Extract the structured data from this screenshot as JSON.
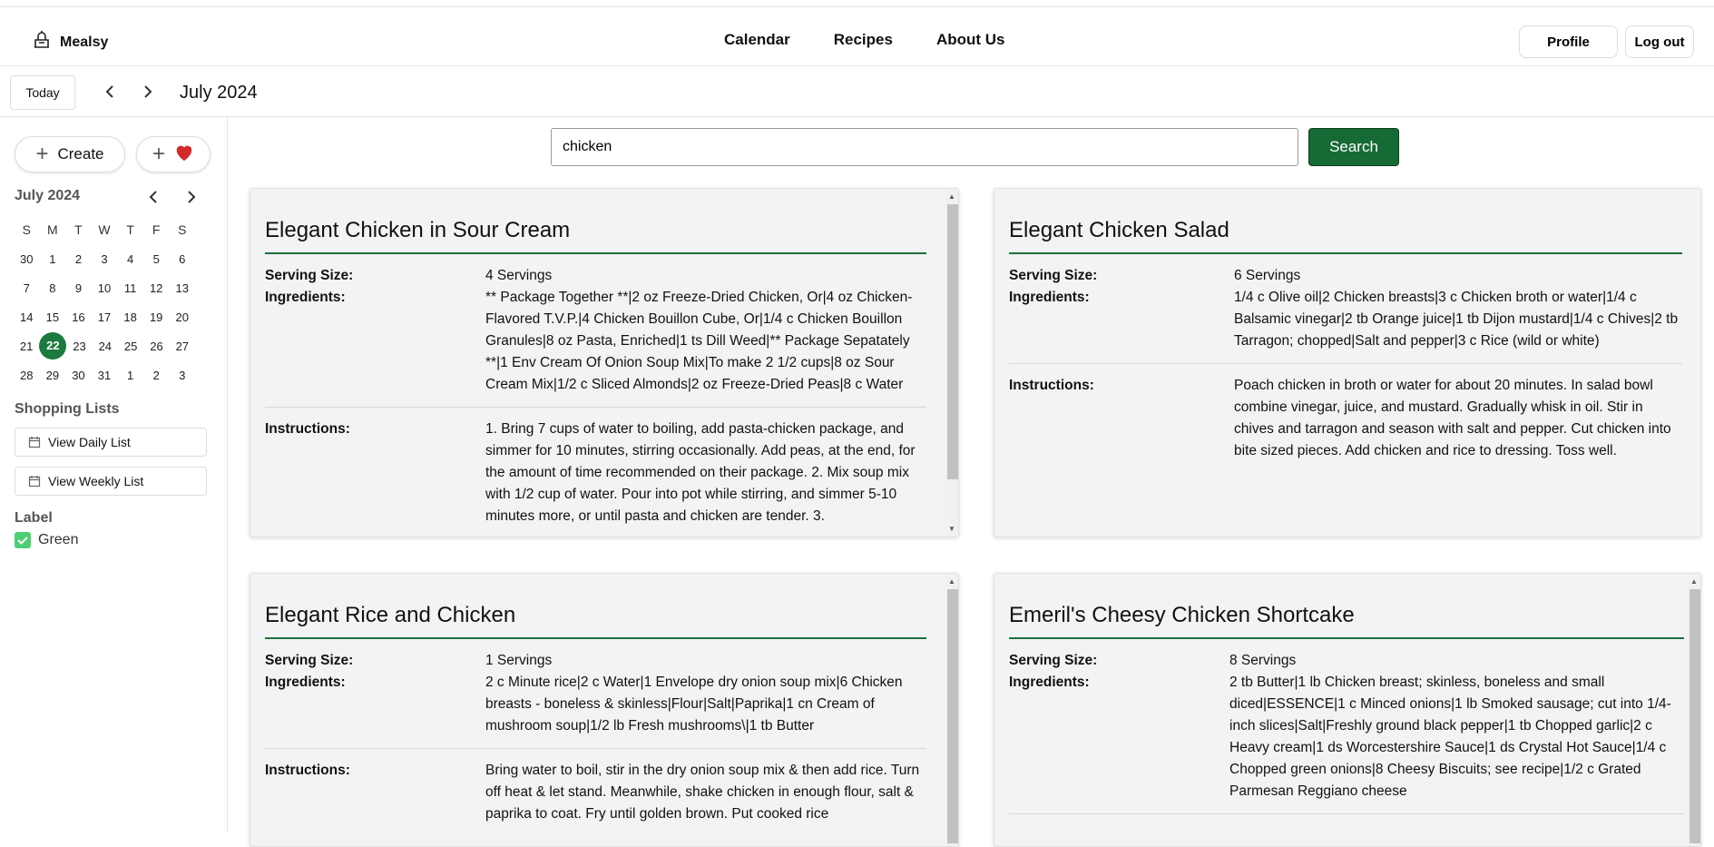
{
  "app": {
    "name": "Mealsy"
  },
  "nav": {
    "links": [
      "Calendar",
      "Recipes",
      "About Us"
    ],
    "profile_label": "Profile",
    "logout_label": "Log out"
  },
  "calendar_bar": {
    "today_label": "Today",
    "month_label": "July 2024"
  },
  "sidebar": {
    "create_label": "Create",
    "favorite_icon": "heart-icon",
    "mini_calendar": {
      "title": "July 2024",
      "weekdays": [
        "S",
        "M",
        "T",
        "W",
        "T",
        "F",
        "S"
      ],
      "weeks": [
        [
          "30",
          "1",
          "2",
          "3",
          "4",
          "5",
          "6"
        ],
        [
          "7",
          "8",
          "9",
          "10",
          "11",
          "12",
          "13"
        ],
        [
          "14",
          "15",
          "16",
          "17",
          "18",
          "19",
          "20"
        ],
        [
          "21",
          "22",
          "23",
          "24",
          "25",
          "26",
          "27"
        ],
        [
          "28",
          "29",
          "30",
          "31",
          "1",
          "2",
          "3"
        ]
      ],
      "selected_day": "22"
    },
    "shopping_title": "Shopping Lists",
    "daily_list_label": "View Daily List",
    "weekly_list_label": "View Weekly List",
    "label_title": "Label",
    "label_item": "Green"
  },
  "search": {
    "value": "chicken",
    "button_label": "Search"
  },
  "recipe_field_labels": {
    "serving": "Serving Size:",
    "ingredients": "Ingredients:",
    "instructions": "Instructions:"
  },
  "recipes": [
    {
      "title": "Elegant Chicken in Sour Cream",
      "serving": "4 Servings",
      "ingredients": "** Package Together **|2 oz Freeze-Dried Chicken, Or|4 oz Chicken-Flavored T.V.P.|4 Chicken Bouillon Cube, Or|1/4 c Chicken Bouillon Granules|8 oz Pasta, Enriched|1 ts Dill Weed|** Package Sepatately **|1 Env Cream Of Onion Soup Mix|To make 2 1/2 cups|8 oz Sour Cream Mix|1/2 c Sliced Almonds|2 oz Freeze-Dried Peas|8 c Water",
      "instructions": "1. Bring 7 cups of water to boiling, add pasta-chicken package, and simmer for 10 minutes, stirring occasionally. Add peas, at the end, for the amount of time recommended on their package. 2. Mix soup mix with 1/2 cup of water. Pour into pot while stirring, and simmer 5-10 minutes more, or until pasta and chicken are tender. 3."
    },
    {
      "title": "Elegant Chicken Salad",
      "serving": "6 Servings",
      "ingredients": "1/4 c Olive oil|2 Chicken breasts|3 c Chicken broth or water|1/4 c Balsamic vinegar|2 tb Orange juice|1 tb Dijon mustard|1/4 c Chives|2 tb Tarragon; chopped|Salt and pepper|3 c Rice (wild or white)",
      "instructions": "Poach chicken in broth or water for about 20 minutes. In salad bowl combine vinegar, juice, and mustard. Gradually whisk in oil. Stir in chives and tarragon and season with salt and pepper. Cut chicken into bite sized pieces. Add chicken and rice to dressing. Toss well."
    },
    {
      "title": "Elegant Rice and Chicken",
      "serving": "1 Servings",
      "ingredients": "2 c Minute rice|2 c Water|1 Envelope dry onion soup mix|6 Chicken breasts - boneless & skinless|Flour|Salt|Paprika|1 cn Cream of mushroom soup|1/2 lb Fresh mushrooms\\|1 tb Butter",
      "instructions": "Bring water to boil, stir in the dry onion soup mix & then add rice. Turn off heat & let stand. Meanwhile, shake chicken in enough flour, salt & paprika to coat. Fry until golden brown. Put cooked rice"
    },
    {
      "title": "Emeril's Cheesy Chicken Shortcake",
      "serving": "8 Servings",
      "ingredients": "2 tb Butter|1 lb Chicken breast; skinless, boneless and small diced|ESSENCE|1 c Minced onions|1 lb Smoked sausage; cut into 1/4-inch slices|Salt|Freshly ground black pepper|1 tb Chopped garlic|2 c Heavy cream|1 ds Worcestershire Sauce|1 ds Crystal Hot Sauce|1/4 c Chopped green onions|8 Cheesy Biscuits; see recipe|1/2 c Grated Parmesan Reggiano cheese",
      "instructions": ""
    }
  ],
  "colors": {
    "accent": "#1b7a3e",
    "button": "#166b35",
    "heart": "#d42a2a",
    "checkbox": "#4ccf73"
  }
}
